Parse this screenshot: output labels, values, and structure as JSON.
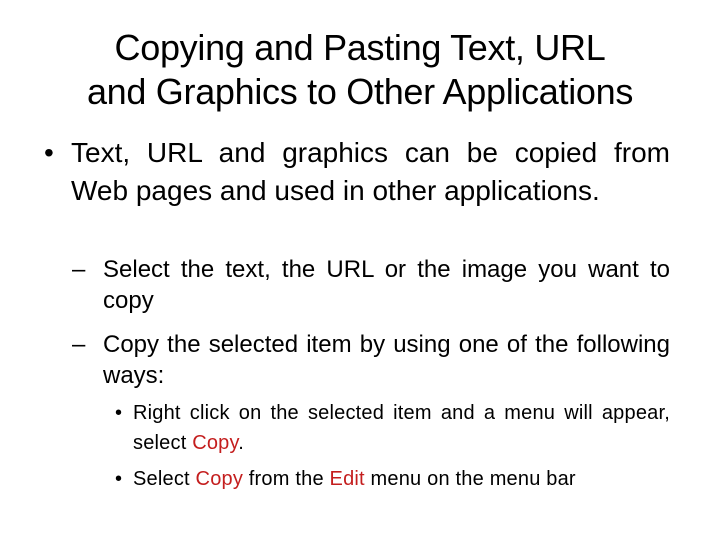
{
  "slide": {
    "title_line1": "Copying and Pasting Text, URL",
    "title_line2": "and Graphics to Other Applications",
    "bullet1": {
      "marker": "•",
      "text": "Text, URL and graphics can be copied from Web pages and used in other applications."
    },
    "sub1": {
      "marker": "–",
      "text": "Select the text, the URL or the image you want to copy"
    },
    "sub2": {
      "marker": "–",
      "text": "Copy the selected item by using one of the following ways:"
    },
    "subsub1": {
      "marker": "•",
      "text_before": "Right click on the selected item and a menu will appear, select ",
      "highlight": "Copy",
      "text_after": "."
    },
    "subsub2": {
      "marker": "•",
      "text_before": "Select ",
      "highlight1": "Copy",
      "text_middle": " from the ",
      "highlight2": "Edit",
      "text_after": " menu on the menu bar"
    },
    "highlight_color": "#c41e1e"
  }
}
